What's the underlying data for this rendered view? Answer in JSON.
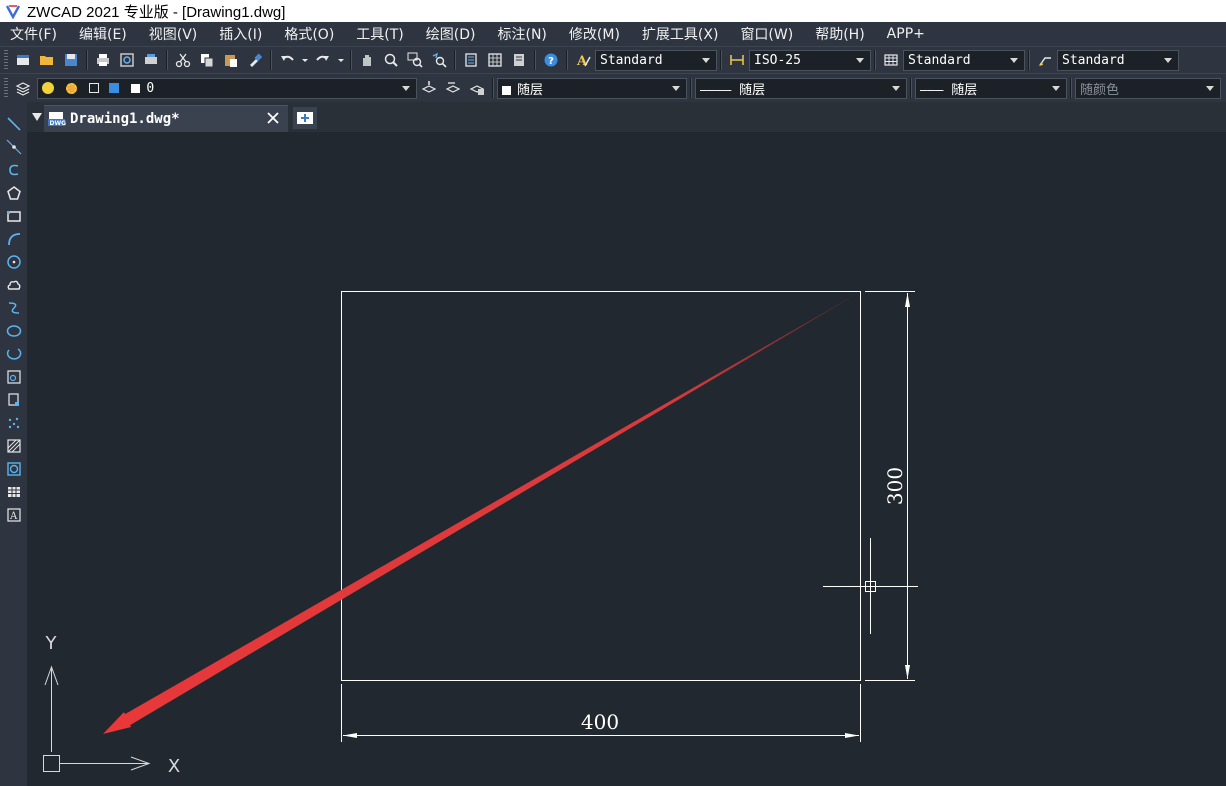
{
  "window": {
    "title": "ZWCAD 2021 专业版 - [Drawing1.dwg]"
  },
  "menu": [
    "文件(F)",
    "编辑(E)",
    "视图(V)",
    "插入(I)",
    "格式(O)",
    "工具(T)",
    "绘图(D)",
    "标注(N)",
    "修改(M)",
    "扩展工具(X)",
    "窗口(W)",
    "帮助(H)",
    "APP+"
  ],
  "toolbar1": {
    "text_style": "Standard",
    "dim_style": "ISO-25",
    "table_style": "Standard",
    "multileader_style": "Standard"
  },
  "toolbar2": {
    "layer": "0",
    "color": "随层",
    "linetype": "———— 随层",
    "lineweight": "——— 随层",
    "plot_style": "随颜色"
  },
  "tabs": [
    {
      "label": "Drawing1.dwg*"
    }
  ],
  "drawing": {
    "width_dim": "400",
    "height_dim": "300",
    "ucs_x": "X",
    "ucs_y": "Y",
    "colors": {
      "geometry": "#ffffff",
      "annotation_arrow": "#e8383a",
      "background": "#212830"
    }
  },
  "icons": {
    "toolbar1": [
      "new-icon",
      "open-icon",
      "save-icon",
      "print-icon",
      "plot-preview-icon",
      "plotter-icon",
      "cut-icon",
      "copy-icon",
      "paste-icon",
      "match-properties-icon",
      "undo-icon",
      "redo-icon",
      "pan-icon",
      "zoom-realtime-icon",
      "zoom-window-icon",
      "zoom-previous-icon",
      "properties-icon",
      "design-center-icon",
      "tool-palette-icon",
      "help-icon"
    ],
    "left": [
      "line-icon",
      "construction-line-icon",
      "polyline-icon",
      "polygon-icon",
      "rectangle-icon",
      "arc-icon",
      "circle-icon",
      "revision-cloud-icon",
      "spline-icon",
      "ellipse-icon",
      "ellipse-arc-icon",
      "insert-block-icon",
      "make-block-icon",
      "point-icon",
      "hatch-icon",
      "region-icon",
      "table-icon",
      "mtext-icon"
    ]
  }
}
